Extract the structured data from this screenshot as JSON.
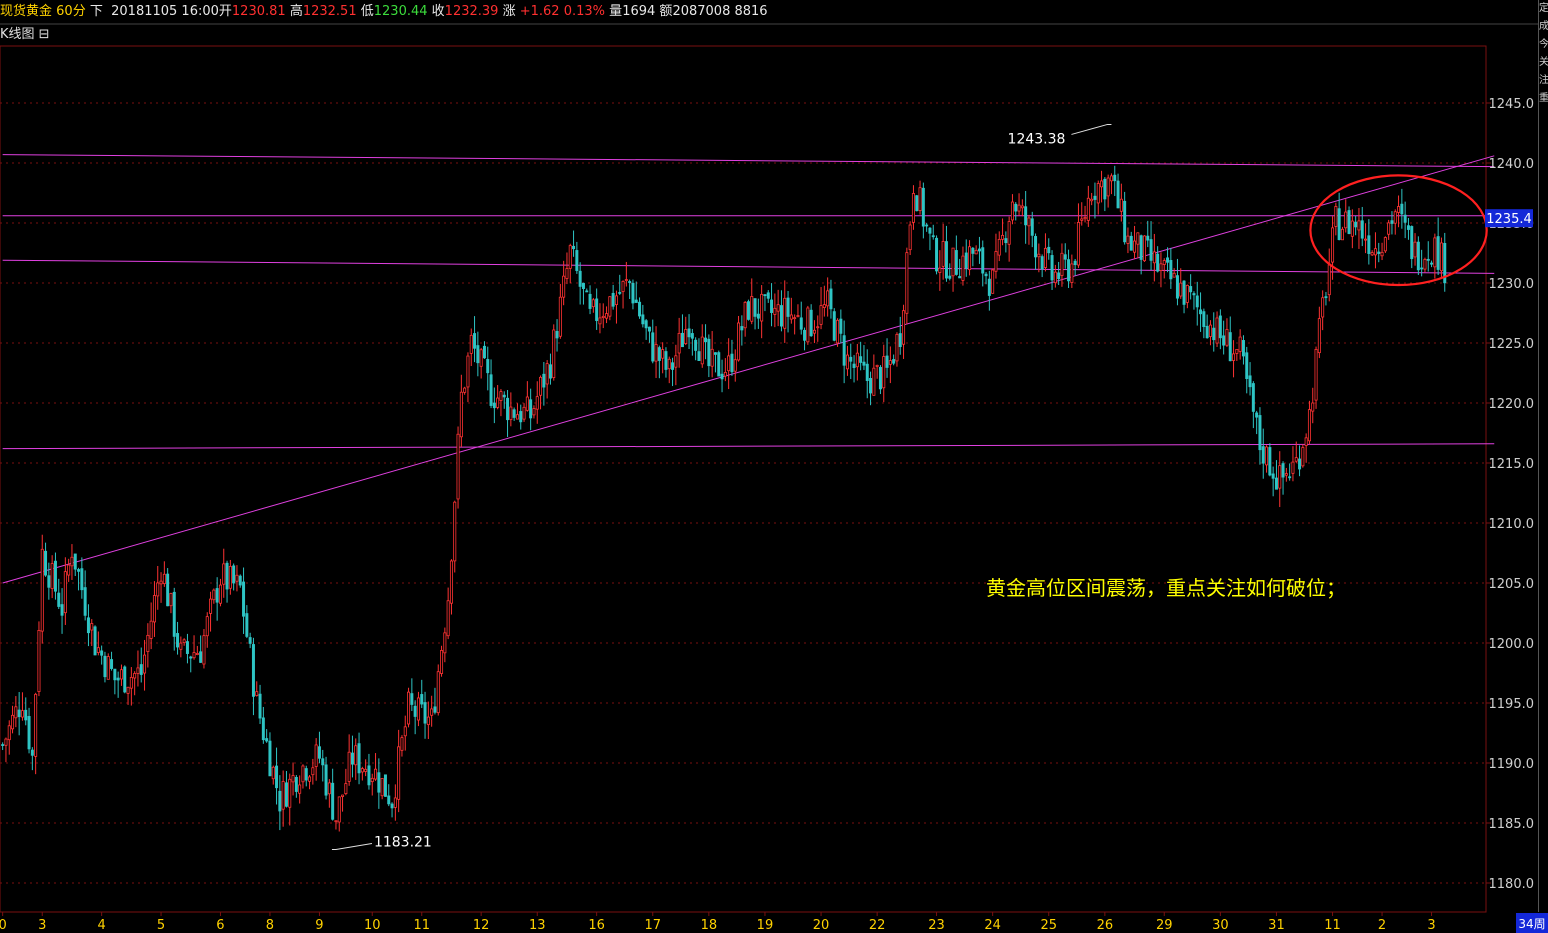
{
  "header": {
    "name": "现货黄金",
    "period": "60分",
    "dir": "下",
    "datetime": "20181105 16:00",
    "open_label": "开",
    "open": "1230.81",
    "high_label": "高",
    "high": "1232.51",
    "low_label": "低",
    "low": "1230.44",
    "close_label": "收",
    "close": "1232.39",
    "change_label": "涨",
    "change": "+1.62",
    "change_pct": "0.13%",
    "volume_label": "量",
    "volume": "1694",
    "amount_label": "额",
    "amount": "2087008",
    "extra": "8816"
  },
  "subtitle": {
    "label": "K线图",
    "collapse_icon": "minus-box-icon"
  },
  "annotation": "黄金高位区间震荡，重点关注如何破位；",
  "right_strip_chars": [
    "定",
    "成",
    "今",
    "关",
    "注",
    "重"
  ],
  "bottom_right_label": "34周",
  "colors": {
    "background": "#000000",
    "up": "#ff3333",
    "down": "#2ec4c4",
    "trendline": "#e040e0",
    "grid": "#7a1010",
    "axis_text": "#d0d0d0",
    "current_price_box": "#1428d8",
    "ellipse": "#ff2020",
    "annotation": "#ffff00"
  },
  "chart_data": {
    "type": "candlestick",
    "title": "现货黄金 60分",
    "y_ticks": [
      1180.0,
      1185.0,
      1190.0,
      1195.0,
      1200.0,
      1205.0,
      1210.0,
      1215.0,
      1220.0,
      1225.0,
      1230.0,
      1235.0,
      1240.0,
      1245.0
    ],
    "ylim": [
      1177.5,
      1248.5
    ],
    "current_price": "1235.4",
    "x_tick_labels": [
      "0",
      "3",
      "4",
      "5",
      "6",
      "8",
      "9",
      "10",
      "11",
      "12",
      "13",
      "16",
      "17",
      "18",
      "19",
      "20",
      "22",
      "23",
      "24",
      "25",
      "26",
      "29",
      "30",
      "31",
      "11",
      "2",
      "3"
    ],
    "x_tick_index": [
      0,
      12,
      30,
      48,
      66,
      81,
      96,
      112,
      127,
      145,
      162,
      180,
      197,
      214,
      231,
      248,
      265,
      283,
      300,
      317,
      334,
      352,
      369,
      386,
      403,
      418,
      433
    ],
    "annotations": [
      {
        "label": "1243.38",
        "index": 336,
        "price": 1243.38
      },
      {
        "label": "1183.21",
        "index": 101,
        "price": 1183.21
      }
    ],
    "support_resistance_lines": [
      {
        "from": {
          "index": 0,
          "price": 1240.7
        },
        "to": {
          "index": 452,
          "price": 1239.7
        }
      },
      {
        "from": {
          "index": 0,
          "price": 1235.6
        },
        "to": {
          "index": 452,
          "price": 1235.6
        }
      },
      {
        "from": {
          "index": 0,
          "price": 1231.9
        },
        "to": {
          "index": 452,
          "price": 1230.8
        }
      },
      {
        "from": {
          "index": 0,
          "price": 1216.2
        },
        "to": {
          "index": 452,
          "price": 1216.6
        }
      },
      {
        "from": {
          "index": 0,
          "price": 1205.0
        },
        "to": {
          "index": 452,
          "price": 1240.6
        }
      }
    ],
    "highlight_ellipse": {
      "center_index": 423,
      "center_price": 1234.4,
      "width_bars": 51,
      "height_price": 7.8
    },
    "keypoints": [
      [
        0,
        1191.5
      ],
      [
        6,
        1195.5
      ],
      [
        9,
        1190.5
      ],
      [
        12,
        1207.5
      ],
      [
        18,
        1203.0
      ],
      [
        21,
        1208.0
      ],
      [
        28,
        1200.0
      ],
      [
        34,
        1197.0
      ],
      [
        42,
        1197.5
      ],
      [
        48,
        1206.5
      ],
      [
        54,
        1199.0
      ],
      [
        60,
        1199.5
      ],
      [
        66,
        1205.5
      ],
      [
        72,
        1204.5
      ],
      [
        77,
        1195.0
      ],
      [
        84,
        1187.0
      ],
      [
        90,
        1189.5
      ],
      [
        96,
        1190.5
      ],
      [
        101,
        1185.5
      ],
      [
        106,
        1190.5
      ],
      [
        112,
        1189.5
      ],
      [
        118,
        1187.0
      ],
      [
        123,
        1194.5
      ],
      [
        130,
        1193.5
      ],
      [
        135,
        1204.0
      ],
      [
        139,
        1220.5
      ],
      [
        142,
        1225.0
      ],
      [
        148,
        1221.0
      ],
      [
        154,
        1219.5
      ],
      [
        160,
        1219.0
      ],
      [
        166,
        1223.5
      ],
      [
        172,
        1232.5
      ],
      [
        178,
        1227.0
      ],
      [
        184,
        1228.5
      ],
      [
        190,
        1230.0
      ],
      [
        196,
        1225.0
      ],
      [
        202,
        1222.5
      ],
      [
        208,
        1227.0
      ],
      [
        214,
        1223.0
      ],
      [
        220,
        1223.0
      ],
      [
        226,
        1228.0
      ],
      [
        232,
        1227.5
      ],
      [
        238,
        1227.5
      ],
      [
        244,
        1226.5
      ],
      [
        250,
        1228.0
      ],
      [
        256,
        1223.5
      ],
      [
        262,
        1222.0
      ],
      [
        268,
        1222.5
      ],
      [
        272,
        1226.0
      ],
      [
        276,
        1238.5
      ],
      [
        282,
        1232.5
      ],
      [
        288,
        1231.5
      ],
      [
        294,
        1232.5
      ],
      [
        300,
        1230.0
      ],
      [
        306,
        1237.0
      ],
      [
        312,
        1234.0
      ],
      [
        318,
        1230.5
      ],
      [
        324,
        1231.5
      ],
      [
        330,
        1238.0
      ],
      [
        336,
        1238.5
      ],
      [
        341,
        1233.5
      ],
      [
        346,
        1232.5
      ],
      [
        351,
        1231.0
      ],
      [
        357,
        1229.5
      ],
      [
        363,
        1227.5
      ],
      [
        369,
        1225.5
      ],
      [
        375,
        1224.0
      ],
      [
        381,
        1216.5
      ],
      [
        387,
        1213.5
      ],
      [
        392,
        1215.0
      ],
      [
        396,
        1219.0
      ],
      [
        400,
        1228.0
      ],
      [
        404,
        1235.0
      ],
      [
        410,
        1235.0
      ],
      [
        416,
        1233.0
      ],
      [
        422,
        1236.0
      ],
      [
        428,
        1232.5
      ],
      [
        434,
        1233.0
      ],
      [
        437,
        1231.5
      ]
    ]
  }
}
